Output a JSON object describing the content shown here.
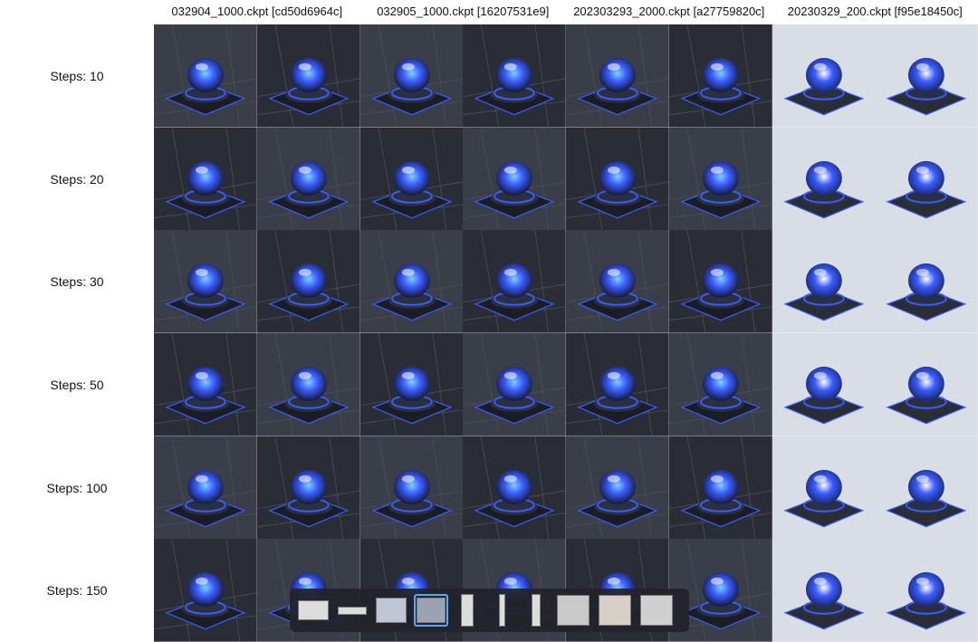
{
  "columns": [
    "032904_1000.ckpt [cd50d6964c]",
    "032905_1000.ckpt [16207531e9]",
    "202303293_2000.ckpt [a27759820c]",
    "20230329_200.ckpt [f95e18450c]"
  ],
  "rows": [
    "Steps: 10",
    "Steps: 20",
    "Steps: 30",
    "Steps: 50",
    "Steps: 100",
    "Steps: 150"
  ],
  "colors": {
    "dark_bg_a": "#2a2d36",
    "dark_bg_b": "#3a3e48",
    "glow_blue": "#3b5cff",
    "glow_cyan": "#7fd0ff",
    "light_bg": "#d8dde6",
    "thumb_strip_bg": "#23232a",
    "selected_border": "#5aa8ff"
  },
  "thumbnail_strip": {
    "selected_index": 3,
    "thumbs": [
      "thumb-1",
      "thumb-2",
      "thumb-3",
      "thumb-4",
      "thumb-5",
      "thumb-6",
      "thumb-7",
      "thumb-8",
      "thumb-9",
      "thumb-10"
    ]
  }
}
